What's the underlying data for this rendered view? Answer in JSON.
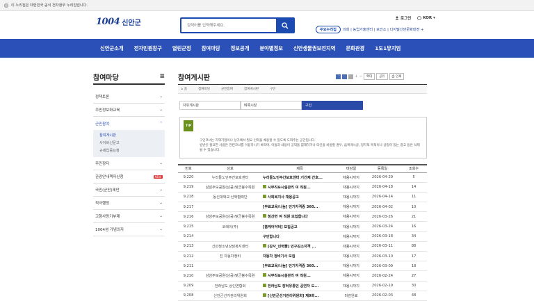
{
  "gov_banner": "이 누리집은 대한민국 공식 전자정부 누리집입니다.",
  "logo": {
    "mark": "1004",
    "name": "신안군"
  },
  "search": {
    "placeholder": "검색어를 입력해주세요."
  },
  "util": {
    "login": "로그인",
    "lang": "KOR"
  },
  "links": {
    "pill": "주요누리집",
    "items": "의회 | 농업기술센터 | 보건소 | 디지털신안문화대전 +"
  },
  "gnb": [
    "신안군소개",
    "전자민원창구",
    "열린군정",
    "참여마당",
    "정보공개",
    "분야별정보",
    "신안생물권보전지역",
    "문화관광",
    "1도1뮤지엄"
  ],
  "lnb": {
    "title": "참여마당",
    "items": [
      "정책토론",
      "주민정보화교육",
      "군민참여",
      "주민장터",
      "관광안내책자신청",
      "국민(군민)제안",
      "적극행정",
      "고향사랑기부제",
      "1004섬 가념의자"
    ],
    "sub": [
      "참여게시판",
      "사이버신문고",
      "규제입증요청"
    ],
    "badge": "NEW"
  },
  "main": {
    "title": "참여게시판"
  },
  "tools": {
    "print": "인쇄",
    "bigger": "확대",
    "smaller": "축소",
    "share": "공유"
  },
  "breadcrumb": [
    "홈",
    "참여마당",
    "군민참여",
    "참여게시판",
    "구인"
  ],
  "tabs": [
    "자유게시판",
    "벼룩시장",
    "구인"
  ],
  "tip": {
    "tag": "TIP",
    "lines": [
      "구인코너는 지역기업이나 상가에서 필요 인력을 채용할 수 있도록 도와주는 공간입니다.",
      "일반인 필요한 사람은 관련코너를 이용하시기 바라며, 이들과 내용이 공익을 침해하거나 타인을 비방할 경우, 음복게시글, 정치적 목적이나 상업이 있는 광고 등은 삭제 될 수 있습니다."
    ]
  },
  "table": {
    "headers": [
      "번호",
      "상호",
      "제목",
      "마감일",
      "등록일",
      "조회수"
    ],
    "rows": [
      [
        "9,220",
        "누리돌노인주간보호센터",
        "누리돌노인주간보호센터 기간제 간호...",
        "채용시까지",
        "2026-04-29",
        "5",
        false
      ],
      [
        "9,219",
        "삼삼주모공원(남공)및군봉수목원",
        "시무직&시설관리 여 직원...",
        "채용시까지",
        "2026-04-18",
        "14",
        true
      ],
      [
        "9,218",
        "동신대학교 산학협력단",
        "사회복지사 채용공고",
        "채용시까지",
        "2026-04-14",
        "11",
        true
      ],
      [
        "9,217",
        "",
        "[무료교육/나눔] 인기자격증 360...",
        "채용시까지",
        "2026-04-02",
        "10",
        false
      ],
      [
        "9,216",
        "삼삼주모공원(남공)및군봉수목원",
        "청산면 여 직원 모집합니다",
        "채용시까지",
        "2026-03-26",
        "21",
        true
      ],
      [
        "9,215",
        "코레이(주)",
        "[홈케어닥터] 모집공고",
        "채용시까지",
        "2026-03-24",
        "16",
        false
      ],
      [
        "9,214",
        "",
        "구인합니다",
        "채용시까지",
        "2026-03-18",
        "34",
        false
      ],
      [
        "9,213",
        "신안청소년상담복지센터",
        "[강사_인력풀] 인구김소자격 ...",
        "채용시까지",
        "2026-03-11",
        "88",
        true
      ],
      [
        "9,212",
        "진 자동차정비",
        "자동차 정비기사 모집",
        "채용시까지",
        "2026-03-10",
        "17",
        false
      ],
      [
        "9,211",
        "",
        "[무료교육/나눔] 인기자격증 360...",
        "채용시까지",
        "2026-03-09",
        "18",
        false
      ],
      [
        "9,210",
        "삼삼주모공원(남공)및군봉수목원",
        "시무직&시설관리 여 직원...",
        "채용시까지",
        "2026-02-24",
        "27",
        true
      ],
      [
        "9,209",
        "전라남도 상인연합회",
        "전라남도 장터유통인 공연자 도...",
        "채용시까지",
        "2026-02-19",
        "30",
        true
      ],
      [
        "9,208",
        "신안군선거관리위원회",
        "[신안군선거관리위원회] 제9회...",
        "마감완료",
        "2026-02-03",
        "48",
        true
      ]
    ]
  }
}
